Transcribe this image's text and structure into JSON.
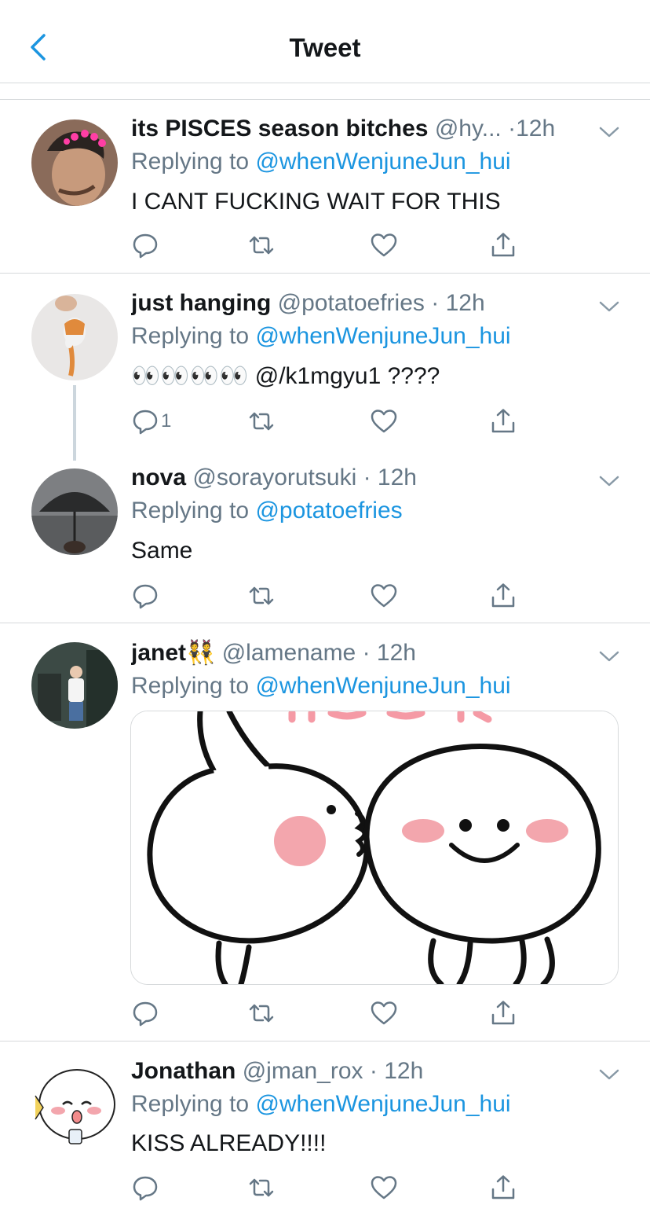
{
  "header": {
    "title": "Tweet"
  },
  "tweets": [
    {
      "name": "its PISCES season bitches",
      "handle": "@hy...",
      "time": "·12h",
      "replying_prefix": "Replying to ",
      "replying_to": "@whenWenjuneJun_hui",
      "text": "I CANT FUCKING WAIT FOR THIS",
      "reply_count": ""
    },
    {
      "name": "just hanging",
      "handle": "@potatoefries",
      "time": "· 12h",
      "replying_prefix": "Replying to ",
      "replying_to": "@whenWenjuneJun_hui",
      "emoji": "👀👀👀👀",
      "text": " @/k1mgyu1 ????",
      "reply_count": "1"
    },
    {
      "name": "nova",
      "handle": "@sorayorutsuki",
      "time": "· 12h",
      "replying_prefix": "Replying to ",
      "replying_to": "@potatoefries",
      "text": "Same",
      "reply_count": ""
    },
    {
      "name": "janet👯",
      "handle": "@lamename",
      "time": "· 12h",
      "replying_prefix": "Replying to ",
      "replying_to": "@whenWenjuneJun_hui",
      "text": "",
      "reply_count": ""
    },
    {
      "name": "Jonathan",
      "handle": "@jman_rox",
      "time": "· 12h",
      "replying_prefix": "Replying to ",
      "replying_to": "@whenWenjuneJun_hui",
      "text": "KISS ALREADY!!!!",
      "reply_count": ""
    }
  ],
  "icons": {
    "back": "chevron-left-icon",
    "more": "chevron-down-icon",
    "reply": "reply-icon",
    "retweet": "retweet-icon",
    "like": "heart-icon",
    "share": "share-icon"
  },
  "colors": {
    "accent": "#1b95e0",
    "secondary_text": "#657786",
    "divider": "#d6d9db",
    "icon": "#657786"
  }
}
